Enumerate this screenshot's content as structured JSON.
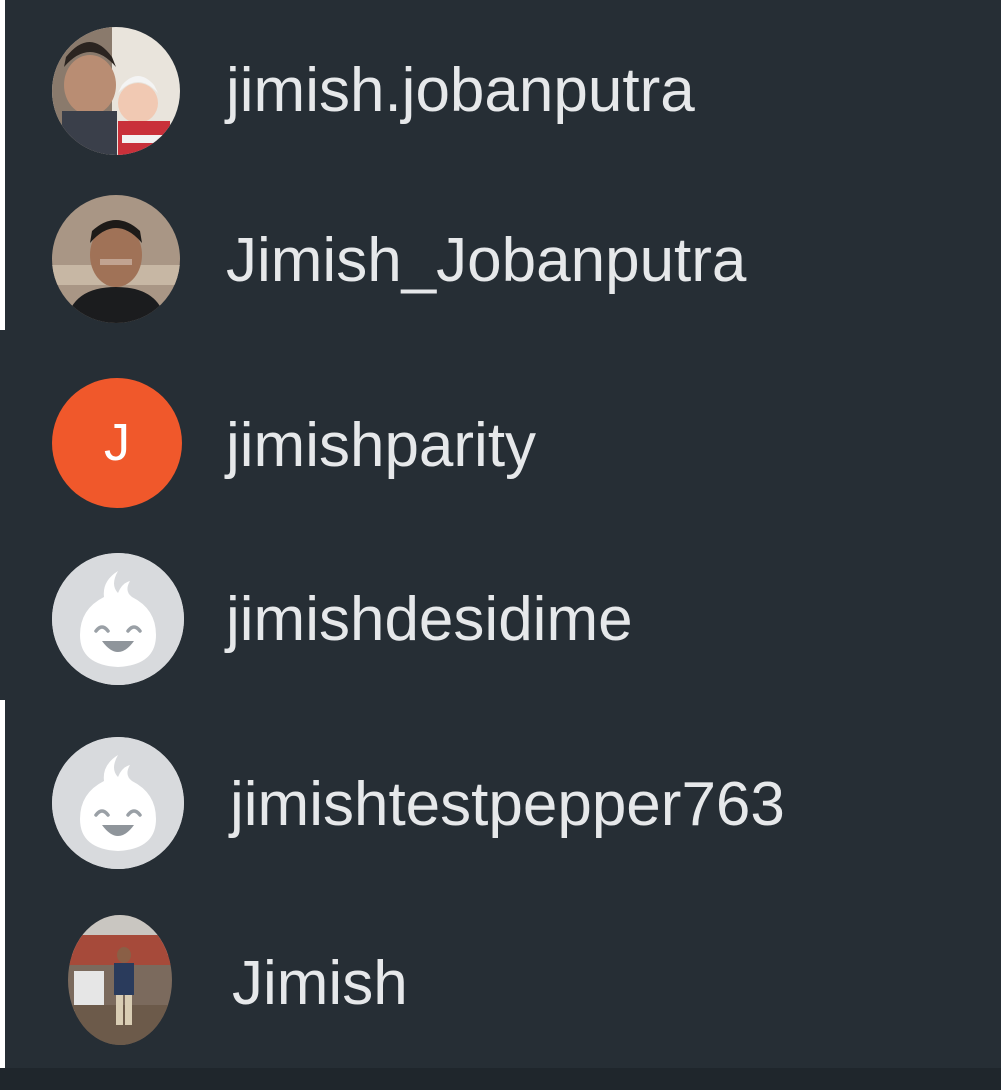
{
  "accounts": [
    {
      "username": "jimish.jobanputra",
      "avatar": "photo-father-daughter"
    },
    {
      "username": "Jimish_Jobanputra",
      "avatar": "photo-portrait"
    },
    {
      "username": "jimishparity",
      "avatar": "letter",
      "initial": "J",
      "color": "#f0582b"
    },
    {
      "username": "jimishdesidime",
      "avatar": "default-flame-mascot",
      "color": "#d8dadd"
    },
    {
      "username": "jimishtestpepper763",
      "avatar": "default-flame-mascot",
      "color": "#d8dadd"
    },
    {
      "username": "Jimish",
      "avatar": "photo-outdoor"
    }
  ]
}
